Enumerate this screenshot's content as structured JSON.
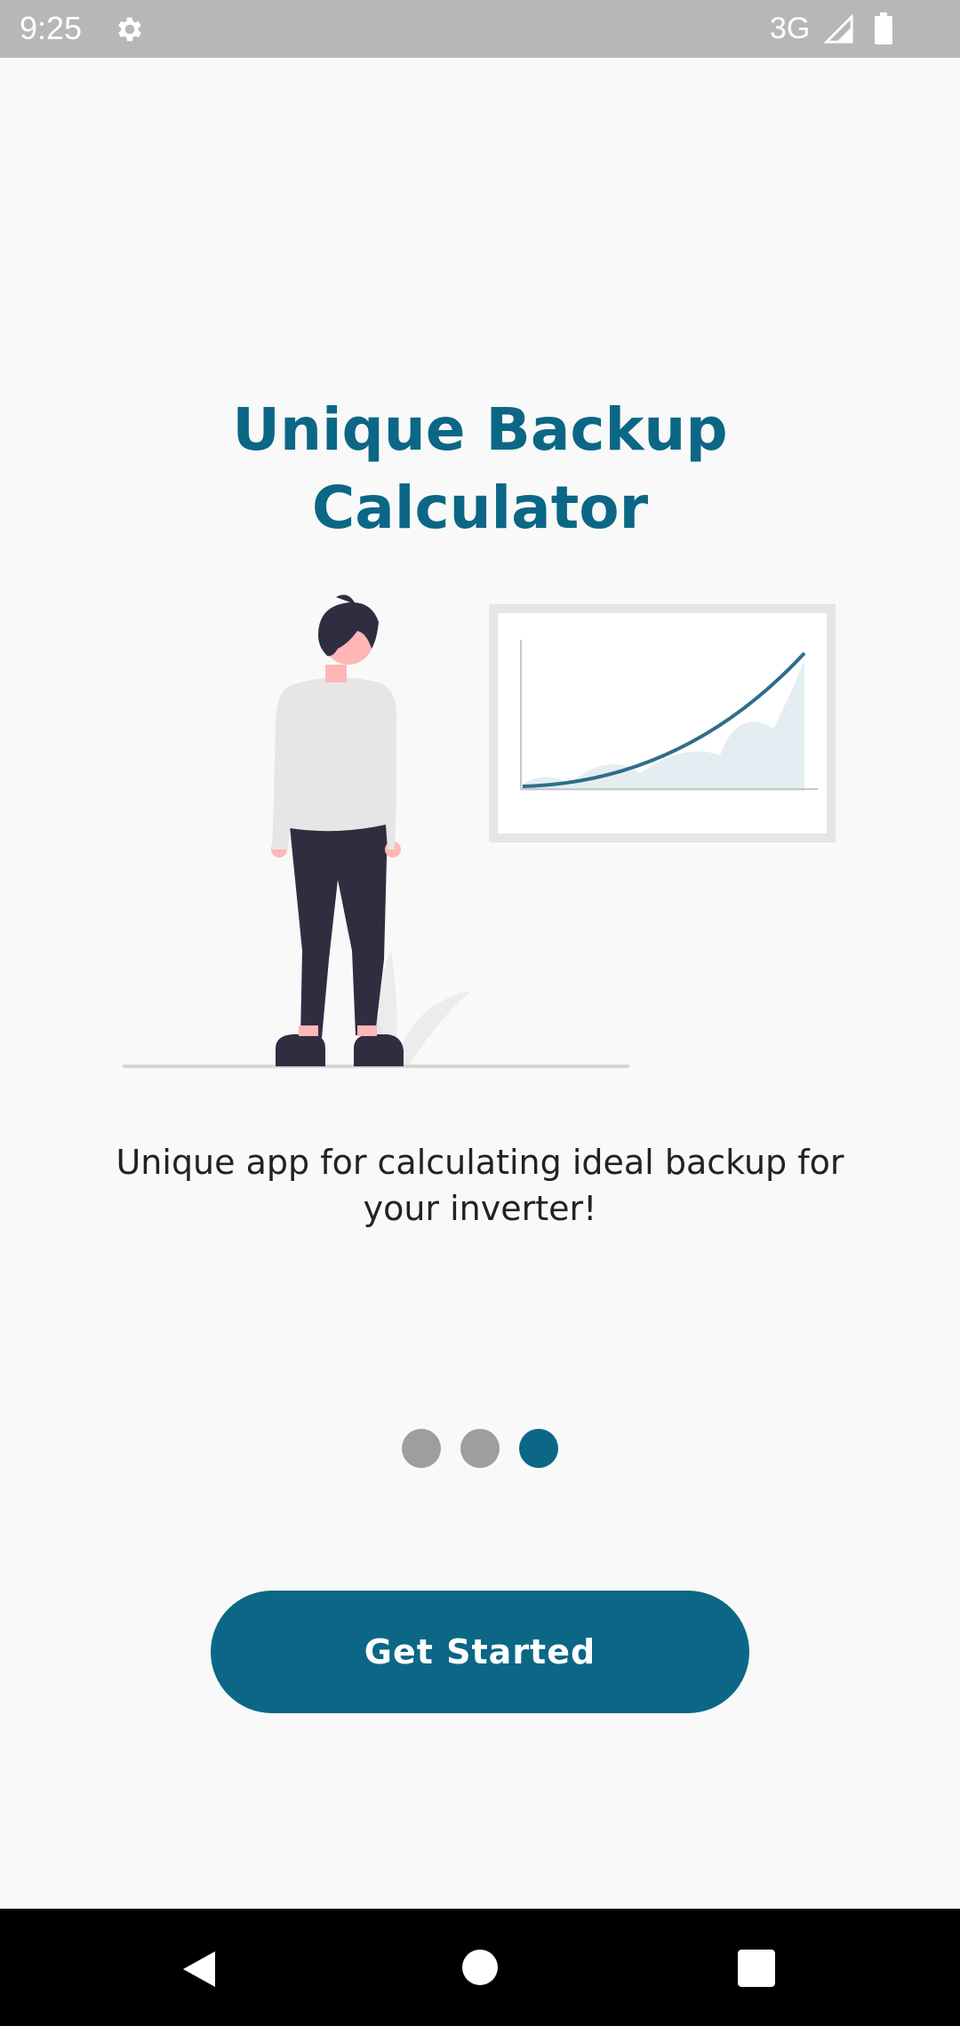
{
  "status_bar": {
    "time": "9:25",
    "network": "3G",
    "icons": [
      "gear-icon",
      "cell-signal-icon",
      "battery-icon"
    ]
  },
  "onboarding": {
    "title": "Unique Backup Calculator",
    "description": "Unique app for calculating ideal backup for your inverter!",
    "illustration": "person-with-growth-chart",
    "pagination": {
      "total": 3,
      "active": 3
    },
    "cta_label": "Get Started"
  },
  "nav_bar": {
    "icons": [
      "back-icon",
      "home-icon",
      "recents-icon"
    ]
  },
  "colors": {
    "primary": "#0b6785",
    "background": "#f9f9f9",
    "status_bar": "#b7b7b7",
    "dot_inactive": "#9e9e9e",
    "text": "#222222"
  }
}
